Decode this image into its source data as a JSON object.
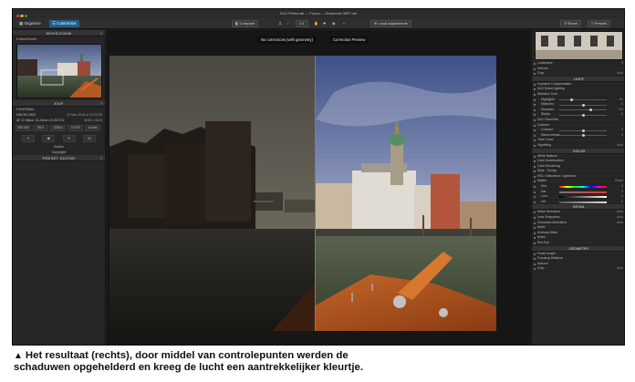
{
  "window": {
    "title": "DxO PhotoLab — Focus — Dordrecht-3597.nef"
  },
  "toolbar": {
    "organize_label": "Organize",
    "customize_label": "Customize",
    "compare_label": "Compare",
    "zoom_label": "1:1",
    "local_adjustments_label": "Local adjustments",
    "reset_label": "Reset",
    "presets_label": "Presets"
  },
  "left_panel": {
    "moveszoom_header": "MOVE/ZOOM",
    "moveszoom_item": "Move/Zoom",
    "exif_header": "EXIF",
    "exif_editor_label": "Exif Editor",
    "exif_camera": "NIKON D800",
    "exif_date": "12 Mar 2018 at 14:23:55",
    "exif_lens": "AF-S Nikkor 14-24mm f/2.8G ED",
    "exif_size": "6036 x 4020",
    "exif_cells": [
      "ISO 100",
      "f/8.0",
      "1/200 s",
      "-0.3 EV",
      "14 mm"
    ],
    "author_label": "Author",
    "copyright_label": "Copyright",
    "preset_editor_header": "PRESET EDITOR"
  },
  "canvas": {
    "label_left": "No corrections (with geometry)",
    "label_right": "Correction Preview"
  },
  "right_panel": {
    "top_rows": [
      {
        "label": "Luminance",
        "val": "0"
      },
      {
        "label": "Horizon",
        "val": ""
      },
      {
        "label": "Crop",
        "val": "Auto"
      }
    ],
    "light_header": "LIGHT",
    "light_rows": [
      {
        "label": "Exposure Compensation",
        "val": ""
      },
      {
        "label": "DxO Smart Lighting",
        "val": ""
      },
      {
        "label": "Selective Tone",
        "val": ""
      },
      {
        "label": "Highlights",
        "val": "-51",
        "slider": true,
        "knob": 0.25
      },
      {
        "label": "Midtones",
        "val": "0",
        "slider": true,
        "knob": 0.5
      },
      {
        "label": "Shadows",
        "val": "+34",
        "slider": true,
        "knob": 0.67
      },
      {
        "label": "Blacks",
        "val": "0",
        "slider": true,
        "knob": 0.5
      },
      {
        "label": "DxO ClearView",
        "val": ""
      },
      {
        "label": "Contrast",
        "val": ""
      },
      {
        "label": "Contrast",
        "val": "0",
        "slider": true,
        "knob": 0.5
      },
      {
        "label": "Microcontrast",
        "val": "0",
        "slider": true,
        "knob": 0.5
      },
      {
        "label": "Tone Curve",
        "val": ""
      },
      {
        "label": "Vignetting",
        "val": "Auto"
      }
    ],
    "color_header": "COLOR",
    "color_rows": [
      {
        "label": "White Balance",
        "val": ""
      },
      {
        "label": "Color Accentuation",
        "val": ""
      },
      {
        "label": "Color Rendering",
        "val": ""
      },
      {
        "label": "Style - Toning",
        "val": ""
      },
      {
        "label": "HSL / Saturation / Lightness",
        "val": ""
      },
      {
        "label": "Master",
        "val": "Reset"
      }
    ],
    "hue_rows": [
      {
        "label": "Hue",
        "val": "0"
      },
      {
        "label": "Sat.",
        "val": "0"
      },
      {
        "label": "Lum.",
        "val": "0"
      },
      {
        "label": "Uni.",
        "val": "0"
      }
    ],
    "detail_header": "DETAIL",
    "detail_rows": [
      {
        "label": "Noise Reduction",
        "val": "Auto"
      },
      {
        "label": "Lens Sharpness",
        "val": "Auto"
      },
      {
        "label": "Chromatic Aberration",
        "val": "Auto"
      },
      {
        "label": "Moiré",
        "val": ""
      },
      {
        "label": "Unsharp Mask",
        "val": ""
      },
      {
        "label": "Moire",
        "val": ""
      },
      {
        "label": "Red Eye",
        "val": ""
      }
    ],
    "geometry_header": "GEOMETRY",
    "geometry_rows": [
      {
        "label": "Focal Length",
        "val": ""
      },
      {
        "label": "Focusing Distance",
        "val": ""
      },
      {
        "label": "Horizon",
        "val": ""
      },
      {
        "label": "Crop",
        "val": "Auto"
      }
    ]
  },
  "caption": {
    "line1": "Het resultaat (rechts), door middel van controlepunten werden de",
    "line2": "schaduwen opgehelderd en kreeg de lucht een aantrekkelijker kleurtje."
  },
  "colors": {
    "accent": "#1f5f8f",
    "panel_bg": "#262626",
    "canvas_bg": "#161616"
  }
}
